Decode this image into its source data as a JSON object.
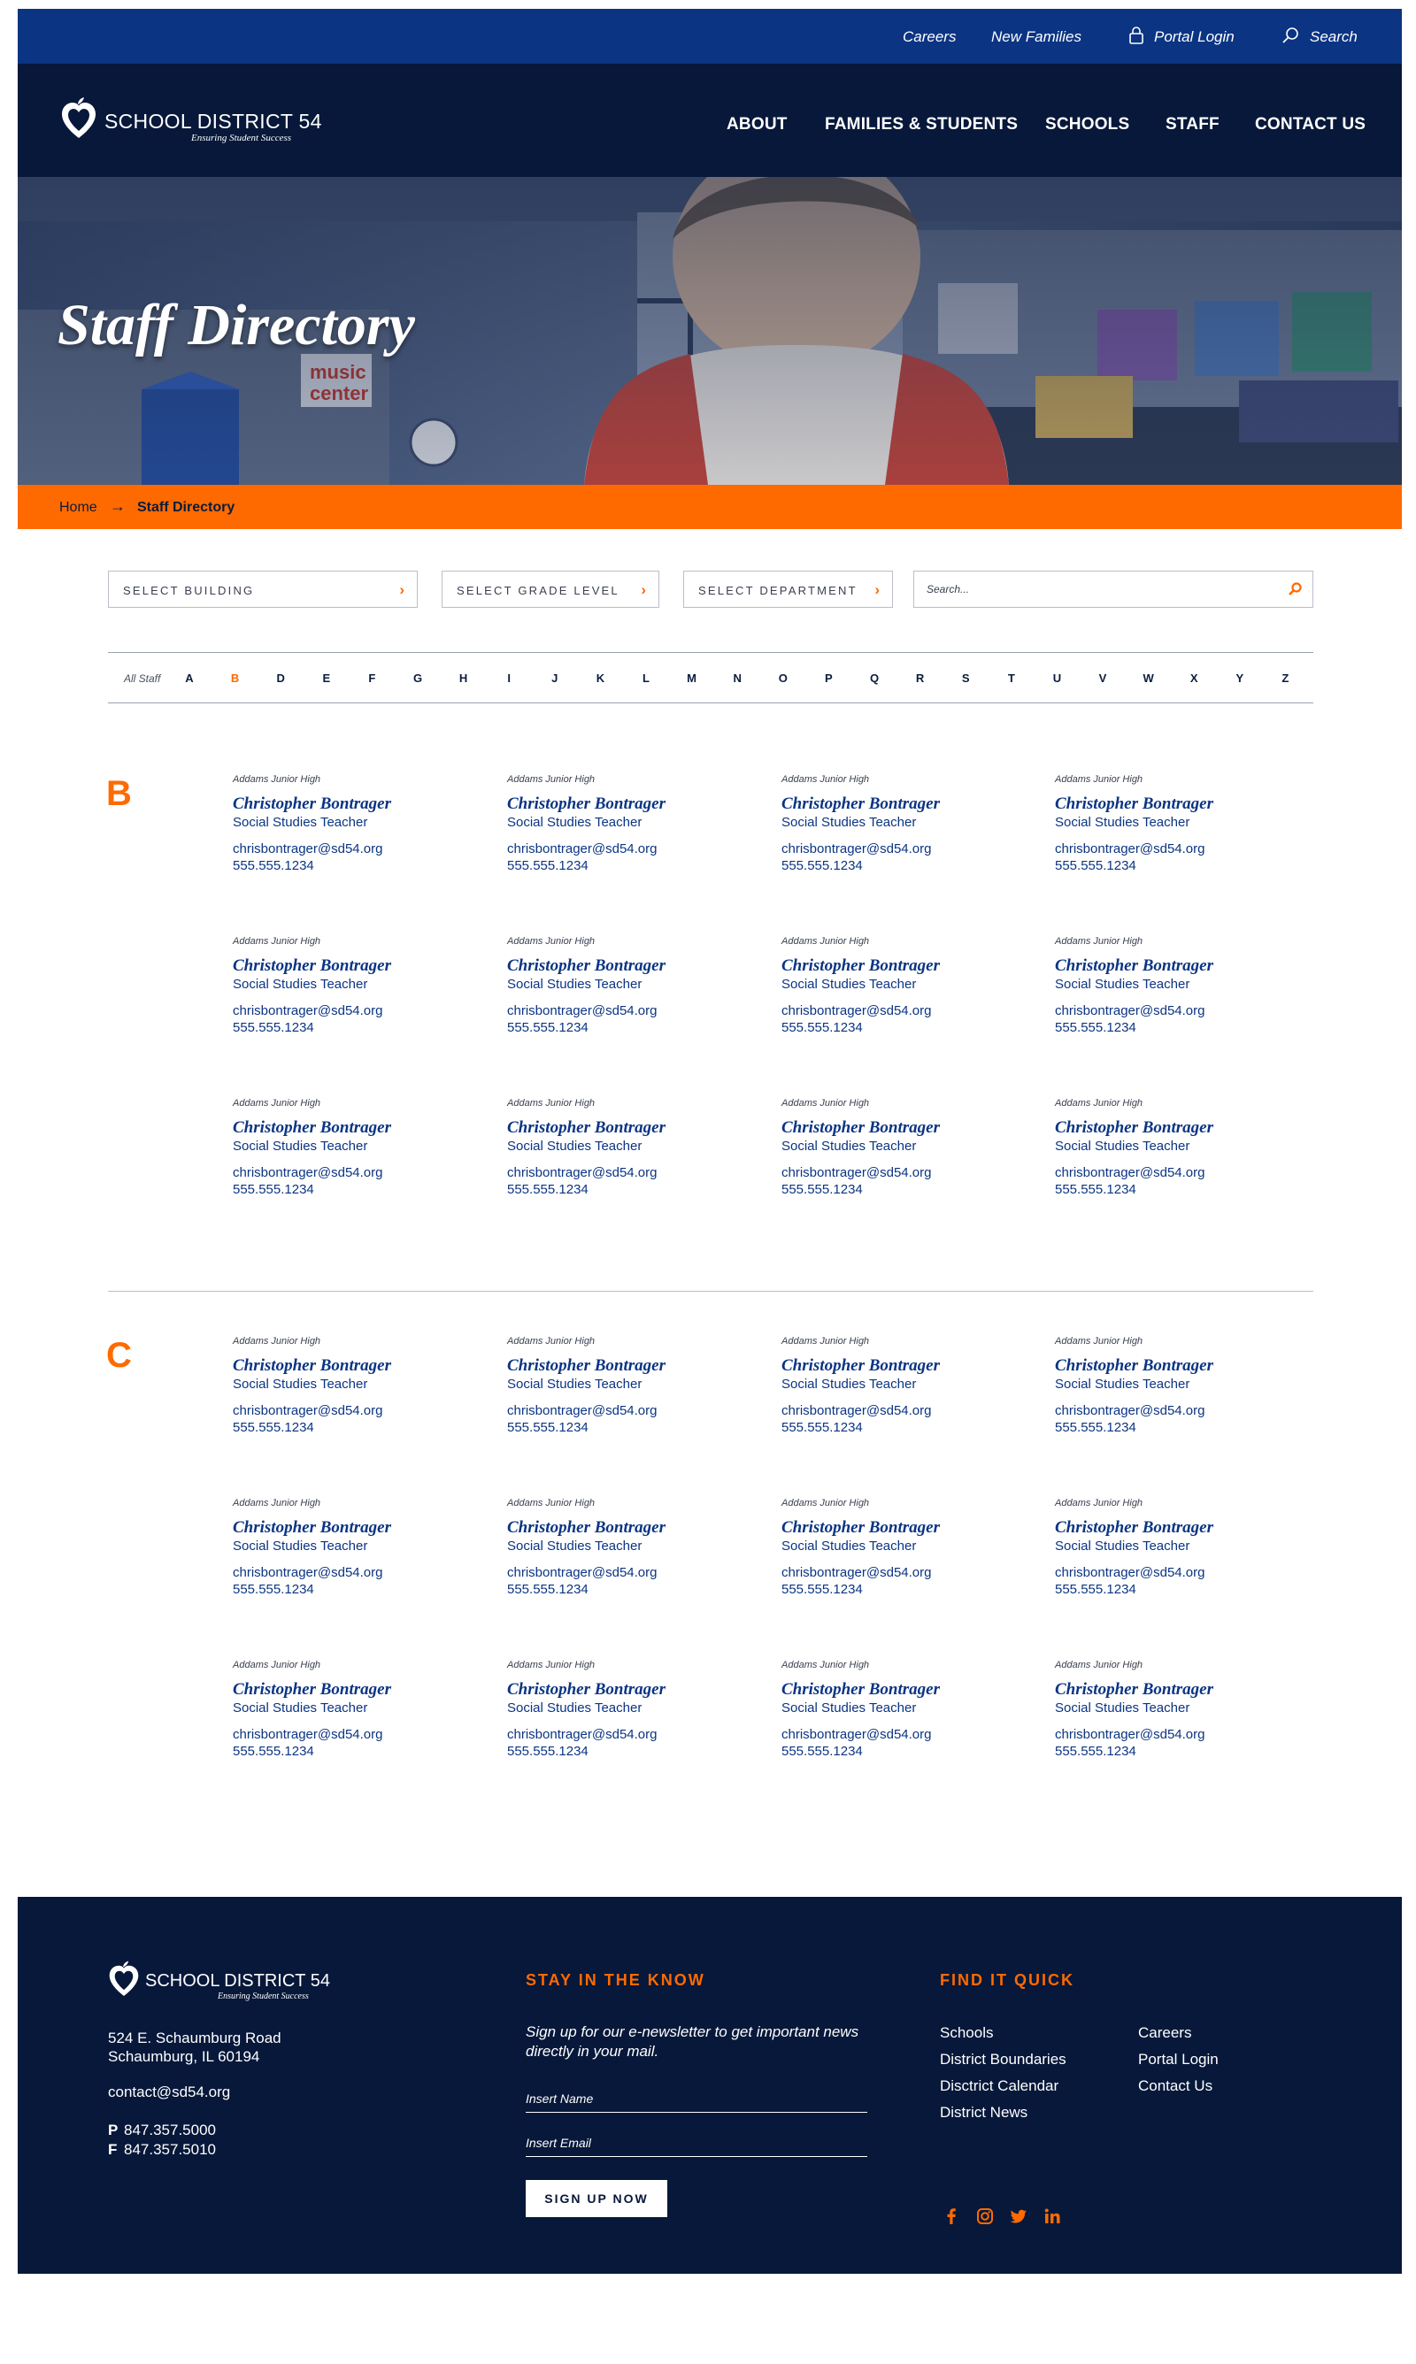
{
  "utility": {
    "careers": "Careers",
    "new_families": "New Families",
    "portal_login": "Portal Login",
    "search": "Search"
  },
  "brand": {
    "name": "SCHOOL DISTRICT 54",
    "tagline": "Ensuring Student Success",
    "colors": {
      "navy": "#07183a",
      "blue": "#0b3483",
      "orange": "#ff6a00"
    }
  },
  "nav": {
    "items": [
      "ABOUT",
      "FAMILIES & STUDENTS",
      "SCHOOLS",
      "STAFF",
      "CONTACT US"
    ]
  },
  "hero": {
    "title": "Staff Directory"
  },
  "breadcrumb": {
    "home": "Home",
    "separator": "→",
    "current": "Staff Directory"
  },
  "filters": {
    "building": "SELECT BUILDING",
    "grade": "SELECT GRADE LEVEL",
    "department": "SELECT DEPARTMENT",
    "search_placeholder": "Search..."
  },
  "alphabet": {
    "all": "All Staff",
    "active": "B",
    "letters": [
      "A",
      "B",
      "D",
      "E",
      "F",
      "G",
      "H",
      "I",
      "J",
      "K",
      "L",
      "M",
      "N",
      "O",
      "P",
      "Q",
      "R",
      "S",
      "T",
      "U",
      "V",
      "W",
      "X",
      "Y",
      "Z"
    ]
  },
  "sections": [
    {
      "letter": "B",
      "staff": [
        {
          "building": "Addams Junior High",
          "name": "Christopher Bontrager",
          "role": "Social Studies Teacher",
          "email": "chrisbontrager@sd54.org",
          "phone": "555.555.1234"
        },
        {
          "building": "Addams Junior High",
          "name": "Christopher Bontrager",
          "role": "Social Studies Teacher",
          "email": "chrisbontrager@sd54.org",
          "phone": "555.555.1234"
        },
        {
          "building": "Addams Junior High",
          "name": "Christopher Bontrager",
          "role": "Social Studies Teacher",
          "email": "chrisbontrager@sd54.org",
          "phone": "555.555.1234"
        },
        {
          "building": "Addams Junior High",
          "name": "Christopher Bontrager",
          "role": "Social Studies Teacher",
          "email": "chrisbontrager@sd54.org",
          "phone": "555.555.1234"
        },
        {
          "building": "Addams Junior High",
          "name": "Christopher Bontrager",
          "role": "Social Studies Teacher",
          "email": "chrisbontrager@sd54.org",
          "phone": "555.555.1234"
        },
        {
          "building": "Addams Junior High",
          "name": "Christopher Bontrager",
          "role": "Social Studies Teacher",
          "email": "chrisbontrager@sd54.org",
          "phone": "555.555.1234"
        },
        {
          "building": "Addams Junior High",
          "name": "Christopher Bontrager",
          "role": "Social Studies Teacher",
          "email": "chrisbontrager@sd54.org",
          "phone": "555.555.1234"
        },
        {
          "building": "Addams Junior High",
          "name": "Christopher Bontrager",
          "role": "Social Studies Teacher",
          "email": "chrisbontrager@sd54.org",
          "phone": "555.555.1234"
        },
        {
          "building": "Addams Junior High",
          "name": "Christopher Bontrager",
          "role": "Social Studies Teacher",
          "email": "chrisbontrager@sd54.org",
          "phone": "555.555.1234"
        },
        {
          "building": "Addams Junior High",
          "name": "Christopher Bontrager",
          "role": "Social Studies Teacher",
          "email": "chrisbontrager@sd54.org",
          "phone": "555.555.1234"
        },
        {
          "building": "Addams Junior High",
          "name": "Christopher Bontrager",
          "role": "Social Studies Teacher",
          "email": "chrisbontrager@sd54.org",
          "phone": "555.555.1234"
        },
        {
          "building": "Addams Junior High",
          "name": "Christopher Bontrager",
          "role": "Social Studies Teacher",
          "email": "chrisbontrager@sd54.org",
          "phone": "555.555.1234"
        }
      ]
    },
    {
      "letter": "C",
      "staff": [
        {
          "building": "Addams Junior High",
          "name": "Christopher Bontrager",
          "role": "Social Studies Teacher",
          "email": "chrisbontrager@sd54.org",
          "phone": "555.555.1234"
        },
        {
          "building": "Addams Junior High",
          "name": "Christopher Bontrager",
          "role": "Social Studies Teacher",
          "email": "chrisbontrager@sd54.org",
          "phone": "555.555.1234"
        },
        {
          "building": "Addams Junior High",
          "name": "Christopher Bontrager",
          "role": "Social Studies Teacher",
          "email": "chrisbontrager@sd54.org",
          "phone": "555.555.1234"
        },
        {
          "building": "Addams Junior High",
          "name": "Christopher Bontrager",
          "role": "Social Studies Teacher",
          "email": "chrisbontrager@sd54.org",
          "phone": "555.555.1234"
        },
        {
          "building": "Addams Junior High",
          "name": "Christopher Bontrager",
          "role": "Social Studies Teacher",
          "email": "chrisbontrager@sd54.org",
          "phone": "555.555.1234"
        },
        {
          "building": "Addams Junior High",
          "name": "Christopher Bontrager",
          "role": "Social Studies Teacher",
          "email": "chrisbontrager@sd54.org",
          "phone": "555.555.1234"
        },
        {
          "building": "Addams Junior High",
          "name": "Christopher Bontrager",
          "role": "Social Studies Teacher",
          "email": "chrisbontrager@sd54.org",
          "phone": "555.555.1234"
        },
        {
          "building": "Addams Junior High",
          "name": "Christopher Bontrager",
          "role": "Social Studies Teacher",
          "email": "chrisbontrager@sd54.org",
          "phone": "555.555.1234"
        },
        {
          "building": "Addams Junior High",
          "name": "Christopher Bontrager",
          "role": "Social Studies Teacher",
          "email": "chrisbontrager@sd54.org",
          "phone": "555.555.1234"
        },
        {
          "building": "Addams Junior High",
          "name": "Christopher Bontrager",
          "role": "Social Studies Teacher",
          "email": "chrisbontrager@sd54.org",
          "phone": "555.555.1234"
        },
        {
          "building": "Addams Junior High",
          "name": "Christopher Bontrager",
          "role": "Social Studies Teacher",
          "email": "chrisbontrager@sd54.org",
          "phone": "555.555.1234"
        },
        {
          "building": "Addams Junior High",
          "name": "Christopher Bontrager",
          "role": "Social Studies Teacher",
          "email": "chrisbontrager@sd54.org",
          "phone": "555.555.1234"
        }
      ]
    }
  ],
  "footer": {
    "address_line1": "524 E. Schaumburg Road",
    "address_line2": "Schaumburg, IL 60194",
    "email": "contact@sd54.org",
    "phone_label": "P",
    "phone": "847.357.5000",
    "fax_label": "F",
    "fax": "847.357.5010",
    "newsletter": {
      "heading": "STAY IN THE KNOW",
      "description": "Sign up for our e-newsletter to get important news directly in your mail.",
      "name_placeholder": "Insert Name",
      "email_placeholder": "Insert Email",
      "button": "SIGN UP NOW"
    },
    "quick": {
      "heading": "FIND IT QUICK",
      "col1": [
        "Schools",
        "District Boundaries",
        "Disctrict Calendar",
        "District News"
      ],
      "col2": [
        "Careers",
        "Portal Login",
        "Contact Us"
      ]
    },
    "social": [
      "facebook-icon",
      "instagram-icon",
      "twitter-icon",
      "linkedin-icon"
    ]
  }
}
